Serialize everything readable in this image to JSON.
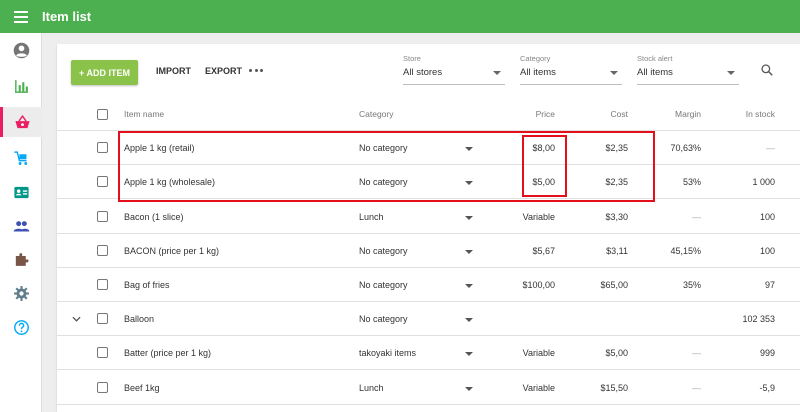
{
  "app": {
    "title": "Item list",
    "accent_color": "#4caf50",
    "add_button_color": "#8bc34a",
    "highlight_color": "#e3101b"
  },
  "sidebar": {
    "items": [
      {
        "icon": "account-icon",
        "color": "#757575"
      },
      {
        "icon": "bar-chart-icon",
        "color": "#4caf50"
      },
      {
        "icon": "basket-icon",
        "color": "#e91e63",
        "active": true
      },
      {
        "icon": "cart-icon",
        "color": "#03a9f4"
      },
      {
        "icon": "contact-card-icon",
        "color": "#009688"
      },
      {
        "icon": "people-icon",
        "color": "#3f51b5"
      },
      {
        "icon": "puzzle-icon",
        "color": "#795548"
      },
      {
        "icon": "gear-icon",
        "color": "#607d8b"
      },
      {
        "icon": "help-icon",
        "color": "#03a9f4"
      }
    ]
  },
  "toolbar": {
    "add_label": "+ ADD ITEM",
    "import_label": "IMPORT",
    "export_label": "EXPORT"
  },
  "filters": {
    "store": {
      "label": "Store",
      "value": "All stores"
    },
    "category": {
      "label": "Category",
      "value": "All items"
    },
    "stock_alert": {
      "label": "Stock alert",
      "value": "All items"
    }
  },
  "table": {
    "headers": {
      "name": "Item name",
      "category": "Category",
      "price": "Price",
      "cost": "Cost",
      "margin": "Margin",
      "in_stock": "In stock"
    },
    "rows": [
      {
        "name": "Apple 1 kg (retail)",
        "category": "No category",
        "price": "$8,00",
        "cost": "$2,35",
        "margin": "70,63%",
        "in_stock": "—"
      },
      {
        "name": "Apple 1 kg (wholesale)",
        "category": "No category",
        "price": "$5,00",
        "cost": "$2,35",
        "margin": "53%",
        "in_stock": "1 000"
      },
      {
        "name": "Bacon (1 slice)",
        "category": "Lunch",
        "price": "Variable",
        "cost": "$3,30",
        "margin": "—",
        "in_stock": "100"
      },
      {
        "name": "BACON (price per 1 kg)",
        "category": "No category",
        "price": "$5,67",
        "cost": "$3,11",
        "margin": "45,15%",
        "in_stock": "100"
      },
      {
        "name": "Bag of fries",
        "category": "No category",
        "price": "$100,00",
        "cost": "$65,00",
        "margin": "35%",
        "in_stock": "97"
      },
      {
        "name": "Balloon",
        "category": "No category",
        "price": "",
        "cost": "",
        "margin": "",
        "in_stock": "102 353",
        "expandable": true
      },
      {
        "name": "Batter (price per 1 kg)",
        "category": "takoyaki items",
        "price": "Variable",
        "cost": "$5,00",
        "margin": "—",
        "in_stock": "999"
      },
      {
        "name": "Beef 1kg",
        "category": "Lunch",
        "price": "Variable",
        "cost": "$15,50",
        "margin": "—",
        "in_stock": "-5,9"
      }
    ]
  }
}
